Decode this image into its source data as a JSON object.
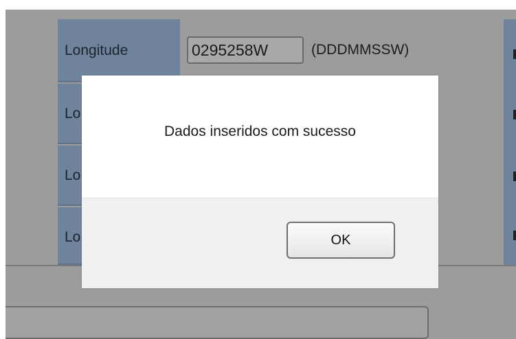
{
  "background_form": {
    "rows": [
      {
        "label": "Longitude"
      },
      {
        "label": "Lo"
      },
      {
        "label": "Lo"
      },
      {
        "label": "Lo"
      }
    ],
    "longitude_value": "0295258W",
    "longitude_format": "(DDDMMSSW)"
  },
  "dialog": {
    "message": "Dados inseridos com sucesso",
    "ok_label": "OK"
  },
  "colors": {
    "label_cell_bg": "#6f849b",
    "page_bg": "#9c9c9c",
    "dialog_bg": "#ffffff",
    "dialog_footer_bg": "#f0f0f0"
  }
}
